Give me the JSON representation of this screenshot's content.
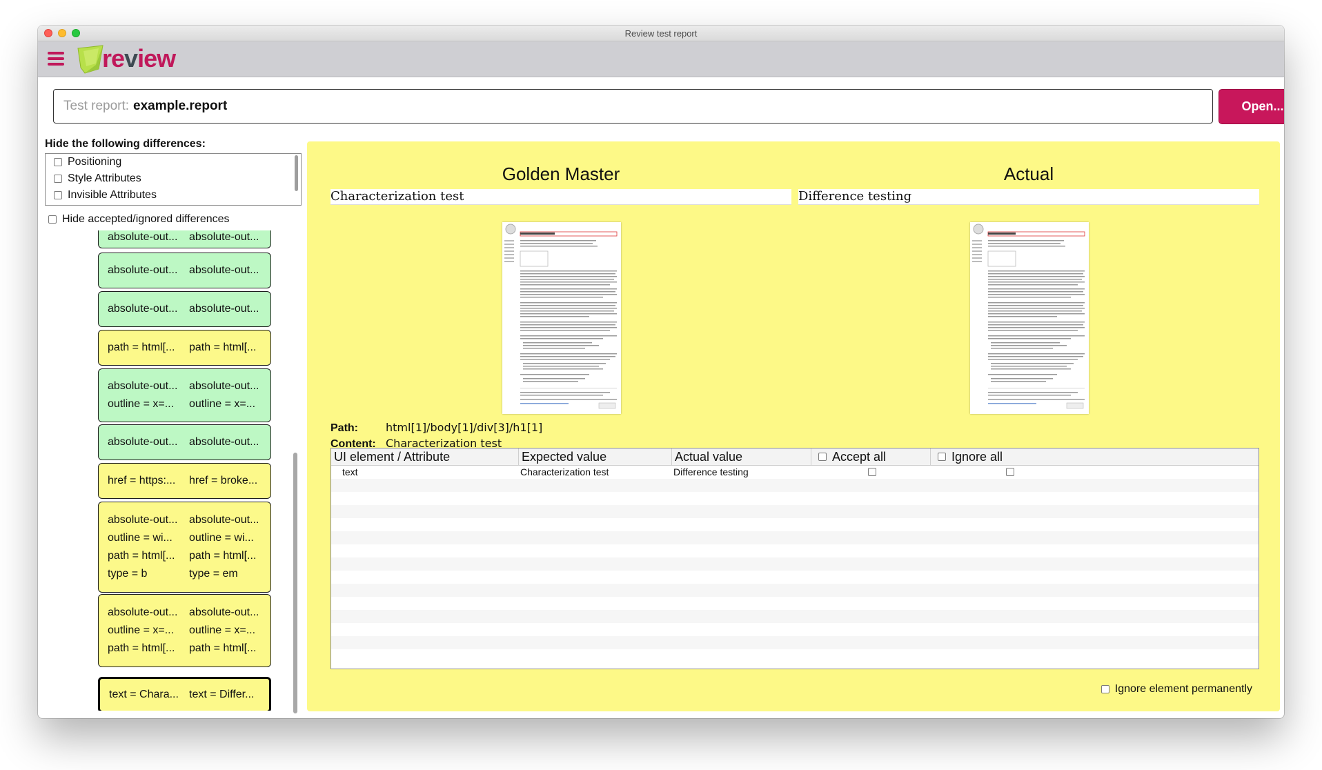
{
  "window": {
    "title": "Review test report"
  },
  "app": {
    "logo_text_prefix": "re",
    "logo_text_v": "v",
    "logo_text_suffix": "iew",
    "colors": {
      "accent": "#c8175b",
      "panel_yellow": "#fdf987",
      "item_green": "#bdf8c4",
      "item_yellow": "#fcf98a"
    }
  },
  "report": {
    "label": "Test report:",
    "value": "example.report",
    "open_label": "Open..."
  },
  "filters": {
    "title": "Hide the following differences:",
    "options": [
      "Positioning",
      "Style Attributes",
      "Invisible Attributes"
    ],
    "hide_accepted_label": "Hide accepted/ignored differences"
  },
  "differences": [
    {
      "color": "green",
      "lines": [
        [
          "absolute-out...",
          "absolute-out..."
        ]
      ]
    },
    {
      "color": "green",
      "lines": [
        [
          "absolute-out...",
          "absolute-out..."
        ]
      ]
    },
    {
      "color": "green",
      "lines": [
        [
          "absolute-out...",
          "absolute-out..."
        ]
      ]
    },
    {
      "color": "yellow",
      "lines": [
        [
          "path = html[...",
          "path = html[..."
        ]
      ]
    },
    {
      "color": "green",
      "lines": [
        [
          "absolute-out...",
          "absolute-out..."
        ],
        [
          "outline = x=...",
          "outline = x=..."
        ]
      ]
    },
    {
      "color": "green",
      "lines": [
        [
          "absolute-out...",
          "absolute-out..."
        ]
      ]
    },
    {
      "color": "yellow",
      "lines": [
        [
          "href = https:...",
          "href = broke..."
        ]
      ]
    },
    {
      "color": "yellow",
      "lines": [
        [
          "absolute-out...",
          "absolute-out..."
        ],
        [
          "outline = wi...",
          "outline = wi..."
        ],
        [
          "path = html[...",
          "path = html[..."
        ],
        [
          "type = b",
          "type = em"
        ]
      ]
    },
    {
      "color": "yellow",
      "lines": [
        [
          "absolute-out...",
          "absolute-out..."
        ],
        [
          "outline = x=...",
          "outline = x=..."
        ],
        [
          "path = html[...",
          "path = html[..."
        ]
      ]
    },
    {
      "color": "yellow",
      "selected": true,
      "lines": [
        [
          "text = Chara...",
          "text = Differ..."
        ]
      ]
    }
  ],
  "detail": {
    "golden_master_heading": "Golden Master",
    "actual_heading": "Actual",
    "golden_title": "Characterization test",
    "actual_title": "Difference testing",
    "path_label": "Path:",
    "path_value": "html[1]/body[1]/div[3]/h1[1]",
    "content_label": "Content:",
    "content_value": "Characterization test",
    "table_headers": {
      "element": "UI element / Attribute",
      "expected": "Expected value",
      "actual": "Actual value",
      "accept_all": "Accept all",
      "ignore_all": "Ignore all"
    },
    "rows": [
      {
        "attribute": "text",
        "expected": "Characterization test",
        "actual": "Difference testing"
      }
    ],
    "ignore_permanently_label": "Ignore element permanently"
  }
}
